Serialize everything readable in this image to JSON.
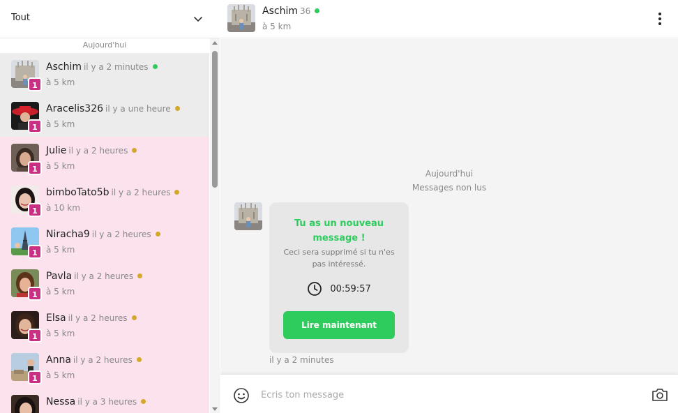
{
  "filter": {
    "label": "Tout",
    "chevron_icon": "chevron-down-icon"
  },
  "list": {
    "day_label": "Aujourd'hui",
    "conversations": [
      {
        "name": "Aschim",
        "time": "il y a 2 minutes",
        "status": "online",
        "distance": "à 5 km",
        "unread": "1",
        "state": "read"
      },
      {
        "name": "Aracelis326",
        "time": "il y a une heure",
        "status": "away",
        "distance": "à 5 km",
        "unread": "1",
        "state": "read"
      },
      {
        "name": "Julie",
        "time": "il y a 2 heures",
        "status": "away",
        "distance": "à 5 km",
        "unread": "1",
        "state": "unread"
      },
      {
        "name": "bimboTato5b",
        "time": "il y a 2 heures",
        "status": "away",
        "distance": "à 10 km",
        "unread": "1",
        "state": "unread"
      },
      {
        "name": "Niracha9",
        "time": "il y a 2 heures",
        "status": "away",
        "distance": "à 5 km",
        "unread": "1",
        "state": "unread"
      },
      {
        "name": "Pavla",
        "time": "il y a 2 heures",
        "status": "away",
        "distance": "à 5 km",
        "unread": "1",
        "state": "unread"
      },
      {
        "name": "Elsa",
        "time": "il y a 2 heures",
        "status": "away",
        "distance": "à 5 km",
        "unread": "1",
        "state": "unread"
      },
      {
        "name": "Anna",
        "time": "il y a 2 heures",
        "status": "away",
        "distance": "à 5 km",
        "unread": "1",
        "state": "unread"
      },
      {
        "name": "Nessa",
        "time": "il y a 3 heures",
        "status": "away",
        "distance": "",
        "unread": "",
        "state": "unread"
      }
    ]
  },
  "chat": {
    "header": {
      "name": "Aschim",
      "age": "36",
      "status": "online",
      "distance": "à 5 km",
      "menu_icon": "more-vertical-icon"
    },
    "day_label": "Aujourd'hui",
    "unread_label": "Messages non lus",
    "card": {
      "title": "Tu as un nouveau message !",
      "subtitle": "Ceci sera supprimé si tu n'es pas intéressé.",
      "timer": "00:59:57",
      "clock_icon": "clock-icon",
      "button": "Lire maintenant"
    },
    "message_time": "il y a 2 minutes",
    "composer": {
      "placeholder": "Écris ton message",
      "value": "",
      "emoji_icon": "emoji-smile-icon",
      "camera_icon": "camera-icon"
    }
  },
  "colors": {
    "accent_green": "#2ecc5d",
    "badge_pink": "#c92f82",
    "unread_bg": "#fbe2ed",
    "read_bg": "#ececec",
    "online_dot": "#2ecc5d",
    "away_dot": "#d4a829"
  }
}
